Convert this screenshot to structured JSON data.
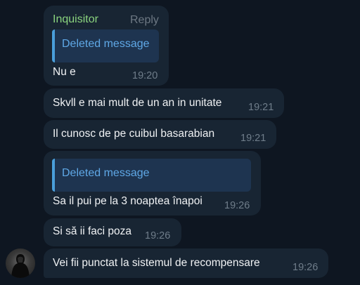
{
  "chat": {
    "messages": [
      {
        "sender": "Inquisitor",
        "reply_label": "Reply",
        "quote": "Deleted message",
        "text": "Nu e",
        "time": "19:20"
      },
      {
        "text": "Skvll e mai mult de un an in unitate",
        "time": "19:21"
      },
      {
        "text": "Il cunosc de pe cuibul basarabian",
        "time": "19:21"
      },
      {
        "quote": "Deleted message",
        "text": "Sa il pui pe la 3 noaptea înapoi",
        "time": "19:26"
      },
      {
        "text": "Si să ii faci poza",
        "time": "19:26"
      },
      {
        "text": "Vei fii punctat la sistemul de recompensare",
        "time": "19:26"
      }
    ]
  },
  "colors": {
    "background": "#0e1621",
    "bubble": "#182533",
    "sender": "#8ad37e",
    "quote_accent": "#4a9eda",
    "quote_text": "#5fa8e6",
    "time": "#6f7d8a"
  },
  "icons": {
    "avatar": "avatar-icon"
  }
}
